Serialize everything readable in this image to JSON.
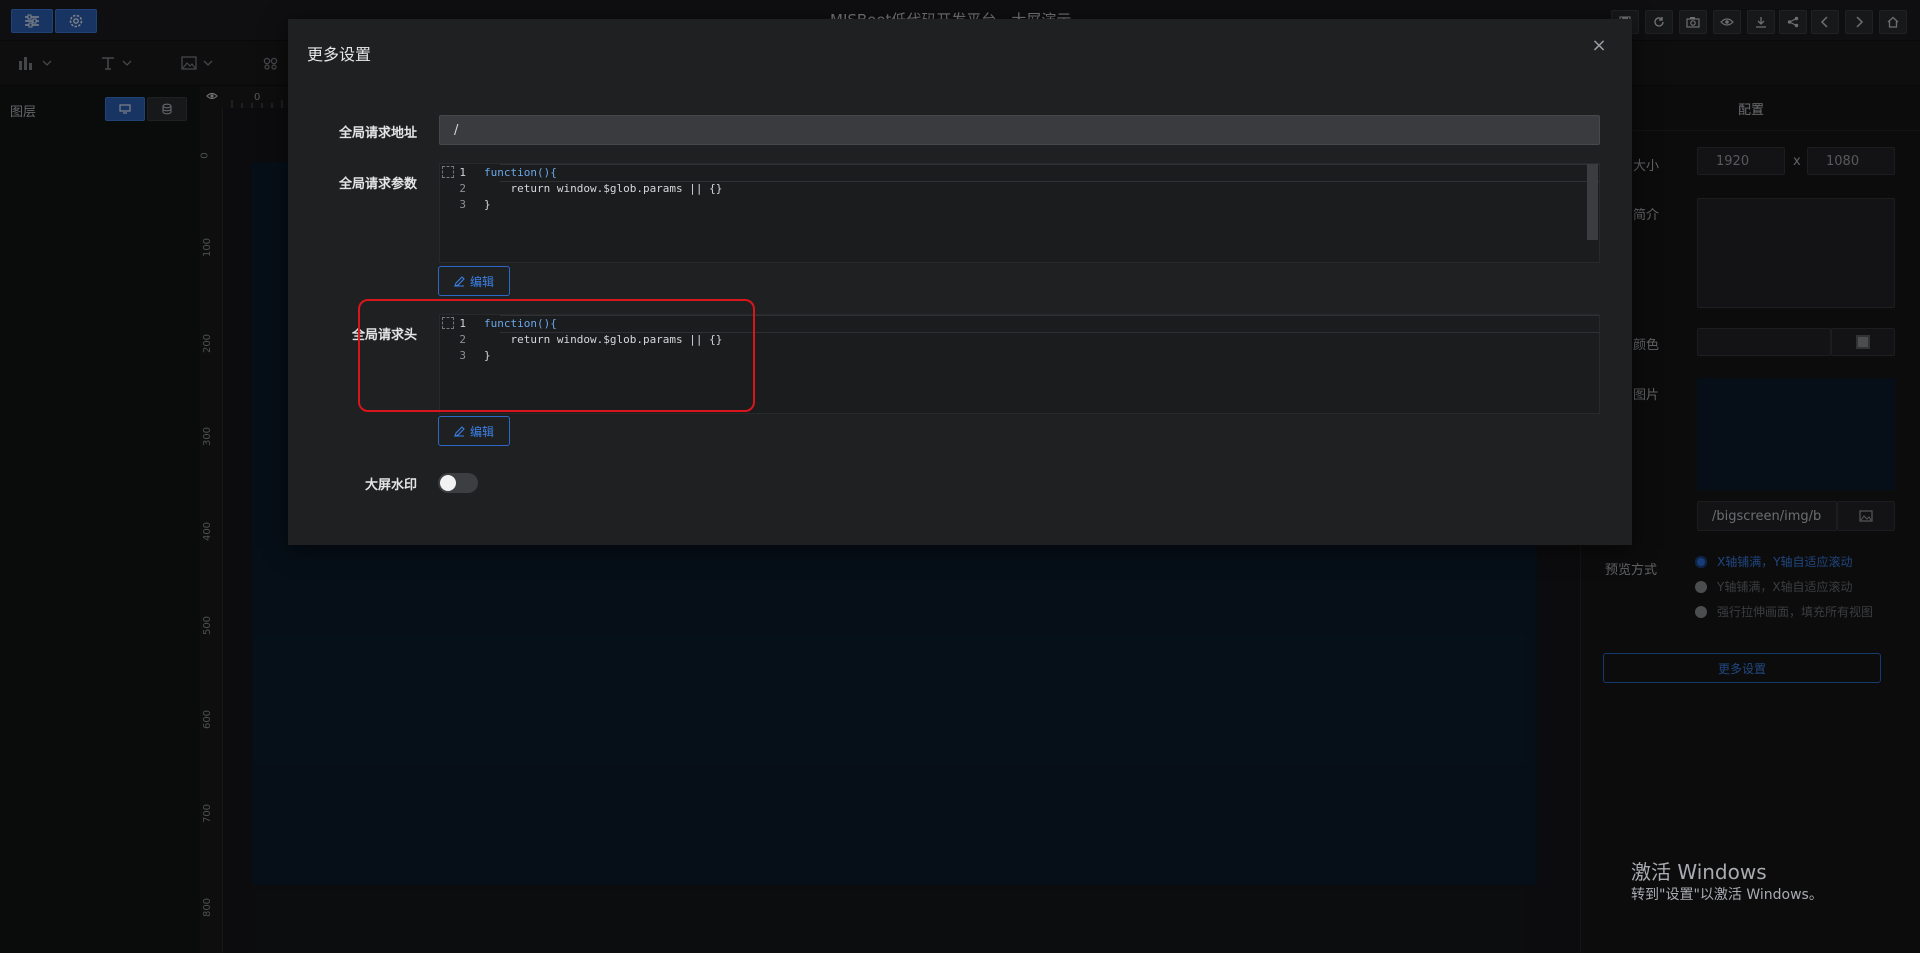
{
  "header": {
    "app_title": "MISBoot低代码开发平台 - 大屏演示",
    "left_buttons": [
      "sliders-icon",
      "gear-icon"
    ],
    "right_icons": [
      "save-icon",
      "refresh-icon",
      "camera-icon",
      "eye-icon",
      "download-icon",
      "share-icon",
      "chevron-left-icon",
      "chevron-right-icon",
      "home-icon"
    ]
  },
  "toolbar": {
    "tools": [
      "chart-icon",
      "text-icon",
      "image-icon",
      "layout-icon"
    ]
  },
  "left_panel": {
    "title": "图层"
  },
  "ruler": {
    "top_start": "0",
    "left_ticks": [
      "0",
      "100",
      "200",
      "300",
      "400",
      "500",
      "600",
      "700",
      "800"
    ]
  },
  "right_panel": {
    "title": "配置",
    "size_label": "大小",
    "width": "1920",
    "height": "1080",
    "times": "x",
    "intro_label": "简介",
    "color_label": "颜色",
    "image_label": "图片",
    "image_path": "/bigscreen/img/b",
    "preview_label": "预览方式",
    "preview_options": [
      "X轴铺满，Y轴自适应滚动",
      "Y轴铺满，X轴自适应滚动",
      "强行拉伸画面，填充所有视图"
    ],
    "more_settings_button": "更多设置"
  },
  "modal": {
    "title": "更多设置",
    "close": "×",
    "url_label": "全局请求地址",
    "url_value": "/",
    "params_label": "全局请求参数",
    "headers_label": "全局请求头",
    "code_lines": [
      "function(){",
      "    return window.$glob.params || {}",
      "}"
    ],
    "line_numbers": [
      "1",
      "2",
      "3"
    ],
    "edit_label": "编辑",
    "watermark_label": "大屏水印",
    "watermark_enabled": false
  },
  "os_watermark": {
    "line1": "激活 Windows",
    "line2": "转到\"设置\"以激活 Windows。"
  },
  "colors": {
    "accent": "#2a6edb",
    "highlight": "#d9161b",
    "screen": "#0b1d2d"
  }
}
